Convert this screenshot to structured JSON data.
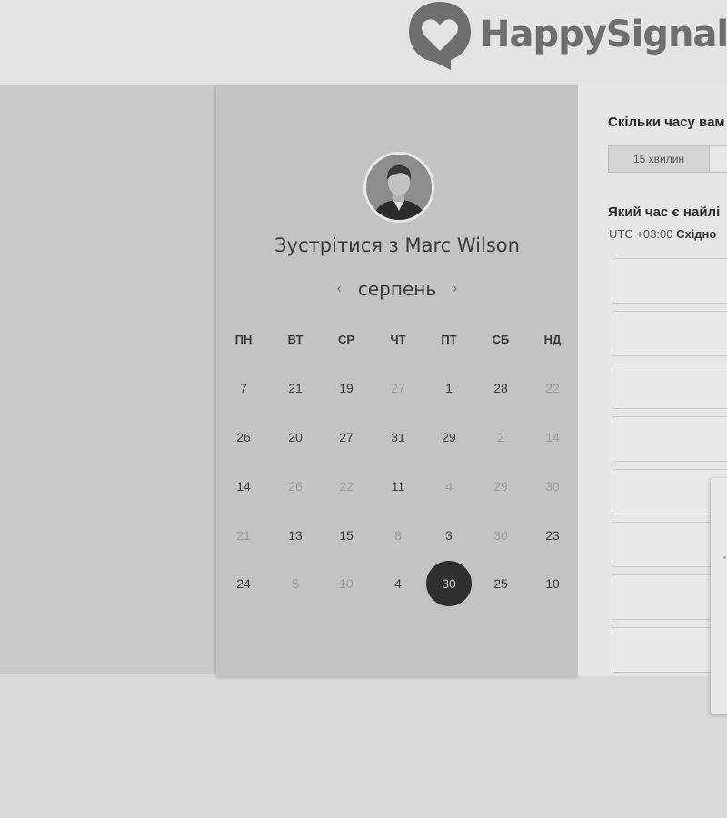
{
  "brand": {
    "name": "HappySignal",
    "logo_icon": "heart-speech-bubble-icon"
  },
  "scheduler": {
    "avatar_icon": "user-photo",
    "title": "Зустрітися з Marc Wilson",
    "month": "серпень",
    "prev_icon": "chevron-left-icon",
    "next_icon": "chevron-right-icon",
    "weekdays": [
      "ПН",
      "ВТ",
      "СР",
      "ЧТ",
      "ПТ",
      "СБ",
      "НД"
    ],
    "weeks": [
      [
        {
          "d": "7",
          "muted": false
        },
        {
          "d": "21",
          "muted": false
        },
        {
          "d": "19",
          "muted": false
        },
        {
          "d": "27",
          "muted": true
        },
        {
          "d": "1",
          "muted": false
        },
        {
          "d": "28",
          "muted": false
        },
        {
          "d": "22",
          "muted": true
        }
      ],
      [
        {
          "d": "26",
          "muted": false
        },
        {
          "d": "20",
          "muted": false
        },
        {
          "d": "27",
          "muted": false
        },
        {
          "d": "31",
          "muted": false
        },
        {
          "d": "29",
          "muted": false
        },
        {
          "d": "2",
          "muted": true
        },
        {
          "d": "14",
          "muted": true
        }
      ],
      [
        {
          "d": "14",
          "muted": false
        },
        {
          "d": "26",
          "muted": true
        },
        {
          "d": "22",
          "muted": true
        },
        {
          "d": "11",
          "muted": false
        },
        {
          "d": "4",
          "muted": true
        },
        {
          "d": "29",
          "muted": true
        },
        {
          "d": "30",
          "muted": true
        }
      ],
      [
        {
          "d": "21",
          "muted": true
        },
        {
          "d": "13",
          "muted": false
        },
        {
          "d": "15",
          "muted": false
        },
        {
          "d": "8",
          "muted": true
        },
        {
          "d": "3",
          "muted": false
        },
        {
          "d": "30",
          "muted": true
        },
        {
          "d": "23",
          "muted": false
        }
      ],
      [
        {
          "d": "24",
          "muted": false
        },
        {
          "d": "5",
          "muted": true
        },
        {
          "d": "10",
          "muted": true
        },
        {
          "d": "4",
          "muted": false
        },
        {
          "d": "30",
          "muted": false,
          "selected": true
        },
        {
          "d": "25",
          "muted": false
        },
        {
          "d": "10",
          "muted": false
        }
      ]
    ]
  },
  "booking": {
    "duration_question": "Скільки часу вам",
    "durations": [
      "15 хвилин"
    ],
    "time_question": "Який час є найлі",
    "tz_offset": "UTC +03:00",
    "tz_name": "Східно",
    "slot_count": 8
  },
  "colors": {
    "selected_day": "#2f2f2f",
    "panel": "#c3c3c3"
  }
}
